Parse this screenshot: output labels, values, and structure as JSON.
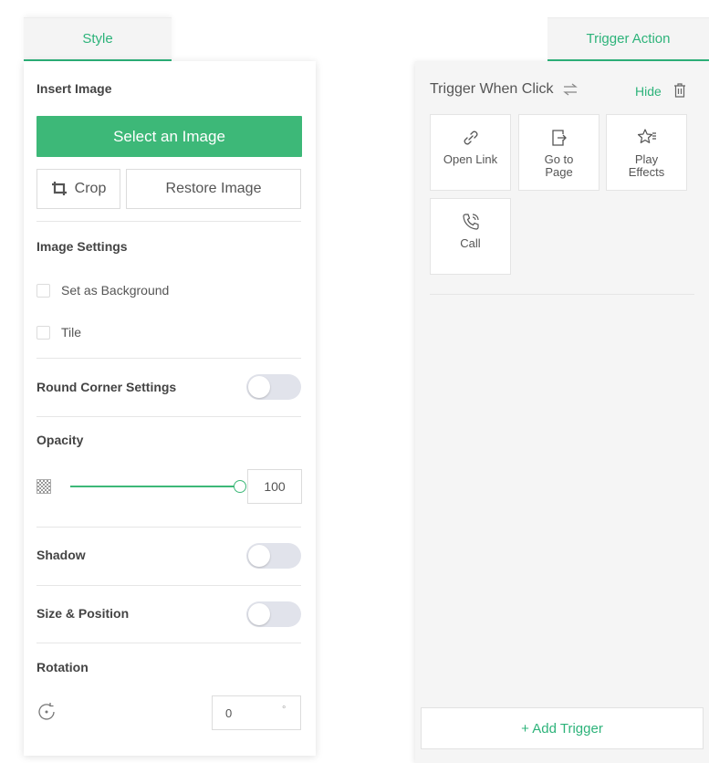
{
  "tabs": {
    "style": "Style",
    "trigger_action": "Trigger Action"
  },
  "style_panel": {
    "insert_image": {
      "title": "Insert Image",
      "select_button": "Select an Image",
      "crop_button": "Crop",
      "restore_button": "Restore Image"
    },
    "image_settings": {
      "title": "Image Settings",
      "options": [
        "Set as Background",
        "Tile"
      ],
      "checked": [
        false,
        false
      ]
    },
    "round_corner": {
      "title": "Round Corner Settings",
      "enabled": false
    },
    "opacity": {
      "title": "Opacity",
      "value": "100",
      "slider_fraction": 1.0
    },
    "shadow": {
      "title": "Shadow",
      "enabled": false
    },
    "size_position": {
      "title": "Size & Position",
      "enabled": false
    },
    "rotation": {
      "title": "Rotation",
      "value": "0",
      "unit": "°"
    }
  },
  "trigger_panel": {
    "header": "Trigger When Click",
    "hide_link": "Hide",
    "actions": [
      {
        "label": "Open Link",
        "icon": "link-icon"
      },
      {
        "label": "Go to Page",
        "icon": "go-to-page-icon"
      },
      {
        "label": "Play Effects",
        "icon": "star-effects-icon"
      },
      {
        "label": "Call",
        "icon": "phone-icon"
      }
    ],
    "add_button": "+ Add Trigger"
  },
  "colors": {
    "accent": "#3db878",
    "toggle_off": "#e1e3eb",
    "right_panel_bg": "#f5f5f5"
  }
}
